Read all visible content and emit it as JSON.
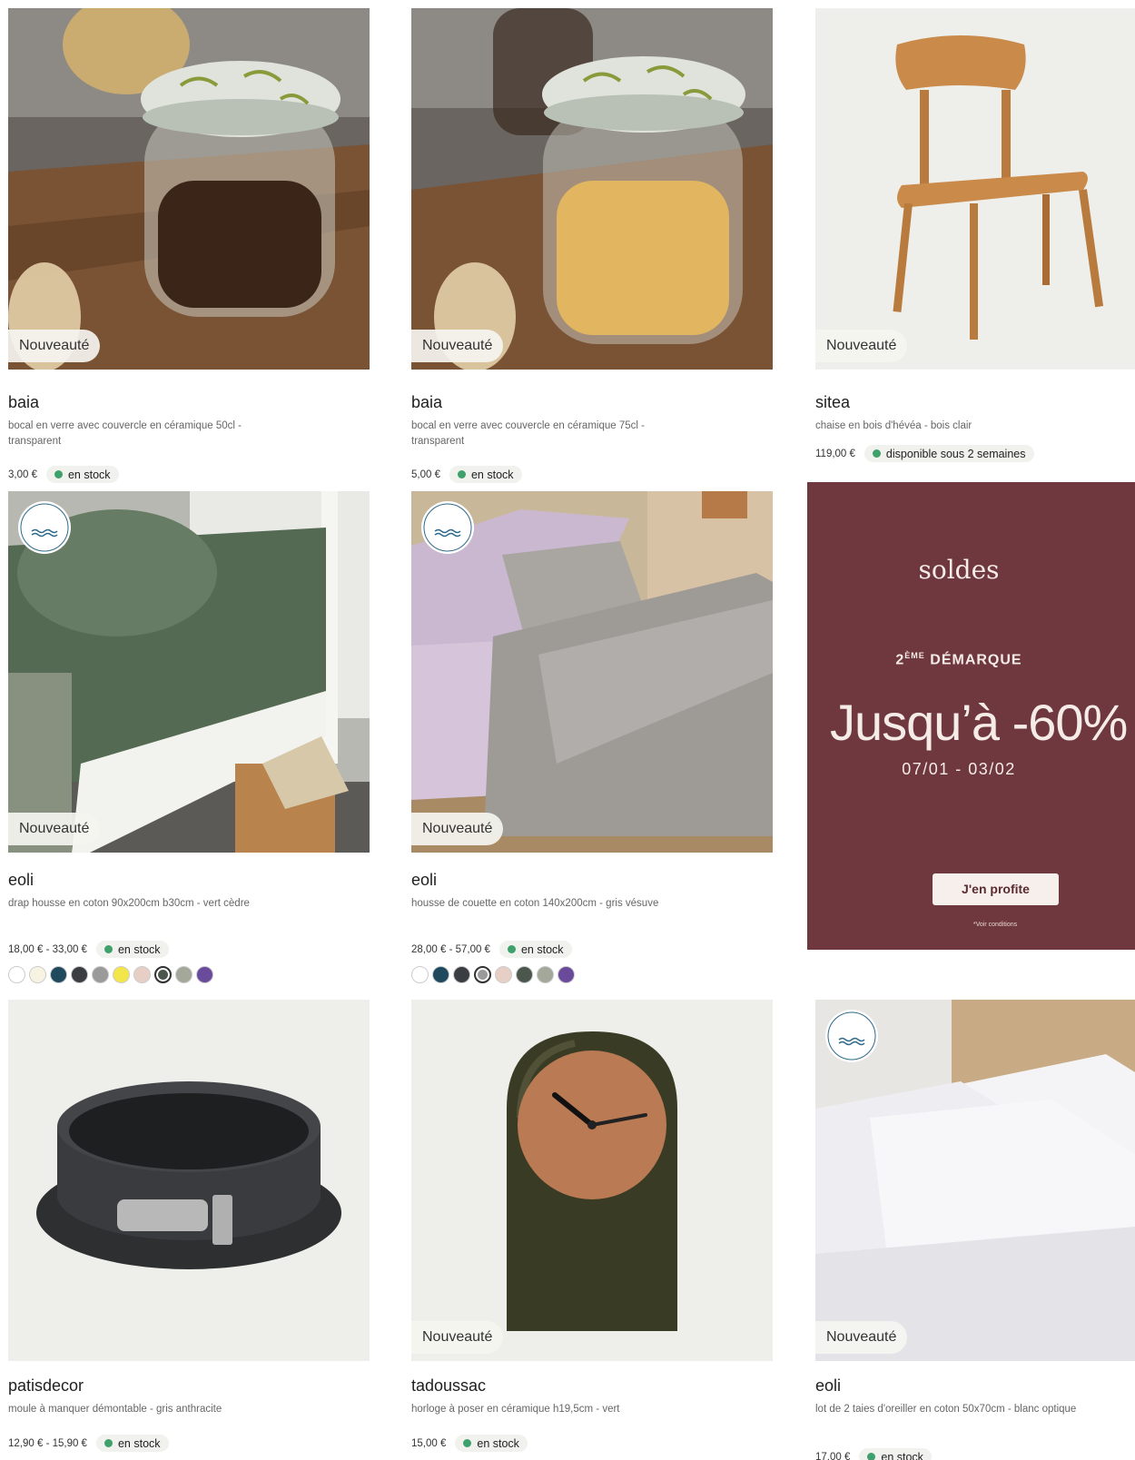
{
  "labels": {
    "new_badge": "Nouveauté"
  },
  "colors": {
    "in_stock": "#3ea06a",
    "promo_bg": "#6f383e",
    "promo_text": "#f5ece8"
  },
  "products": [
    {
      "name": "baia",
      "desc": "bocal en verre avec couvercle en céramique 50cl - transparent",
      "price": "3,00 €",
      "stock": "en stock",
      "badge": "Nouveauté"
    },
    {
      "name": "baia",
      "desc": "bocal en verre avec couvercle en céramique 75cl - transparent",
      "price": "5,00 €",
      "stock": "en stock",
      "badge": "Nouveauté"
    },
    {
      "name": "sitea",
      "desc": "chaise en bois d'hévéa - bois clair",
      "price": "119,00 €",
      "stock": "disponible sous 2 semaines",
      "badge": "Nouveauté"
    },
    {
      "name": "eoli",
      "desc": "drap housse en coton 90x200cm b30cm - vert cèdre",
      "price": "18,00 € - 33,00 €",
      "stock": "en stock",
      "badge": "Nouveauté",
      "made_in": [
        "MADE IN",
        "BASSIN",
        "MÉDITERRANÉEN"
      ]
    },
    {
      "name": "eoli",
      "desc": "housse de couette en coton 140x200cm - gris vésuve",
      "price": "28,00 € - 57,00 €",
      "stock": "en stock",
      "badge": "Nouveauté",
      "made_in": [
        "MADE IN",
        "BASSIN",
        "MÉDITERRANÉEN"
      ]
    },
    {
      "name": "patisdecor",
      "desc": "moule à manquer démontable - gris anthracite",
      "price": "12,90 € - 15,90 €",
      "stock": "en stock"
    },
    {
      "name": "tadoussac",
      "desc": "horloge à poser en céramique h19,5cm - vert",
      "price": "15,00 €",
      "stock": "en stock",
      "badge": "Nouveauté"
    },
    {
      "name": "eoli",
      "desc": "lot de 2 taies d'oreiller en coton 50x70cm - blanc optique",
      "price": "17,00 €",
      "stock": "en stock",
      "badge": "Nouveauté",
      "made_in": [
        "MADE IN",
        "BASSIN",
        "MÉDITERRANÉEN"
      ]
    }
  ],
  "swatches_eoli_drap": [
    "#ffffff",
    "#f7f3e3",
    "#1f4a5e",
    "#3a3d42",
    "#9a9a9a",
    "#f3e64a",
    "#e8cfc6",
    "#4b574c",
    "#a3a89a",
    "#6a4a9a"
  ],
  "swatches_eoli_housse": [
    "#ffffff",
    "#1f4a5e",
    "#3a3d42",
    "#9a9a9a",
    "#e8cfc6",
    "#4b574c",
    "#a3a89a",
    "#6a4a9a"
  ],
  "promo": {
    "soldes": "soldes",
    "demarque_num": "2",
    "demarque_sup": "ÈME",
    "demarque_text": " DÉMARQUE",
    "headline": "Jusqu’à -60%",
    "dates": "07/01 - 03/02",
    "cta": "J'en profite",
    "conditions": "*Voir conditions"
  }
}
